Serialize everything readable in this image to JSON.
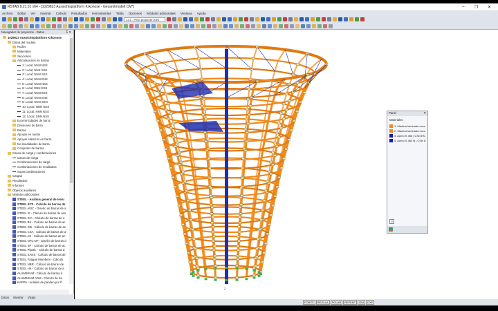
{
  "window": {
    "title": "RSTAB 8.21.01 x64 - [1029823 Aussichtsplattform Krkonose - Gesamtmodell CM*]",
    "minimize": "–",
    "maximize": "❐",
    "close": "✕"
  },
  "menu": [
    "Archivo",
    "Editar",
    "Ver",
    "Insertar",
    "Cálculo",
    "Resultados",
    "Herramientas",
    "Tabla",
    "Opciones",
    "Módulos adicionales",
    "Ventana",
    "Ayuda"
  ],
  "toolbar": {
    "load_case": "CC1 - Peso propio de la es"
  },
  "navigator": {
    "title": "Navegador de proyectos - Datos",
    "pin": "⊼ ✕",
    "items": [
      {
        "l": "1029823 Aussichtsplattform Krkonose",
        "d": 0,
        "t": "root"
      },
      {
        "l": "Datos del modelo",
        "d": 1,
        "t": "f"
      },
      {
        "l": "Nudos",
        "d": 2,
        "t": "f"
      },
      {
        "l": "Materiales",
        "d": 2,
        "t": "f"
      },
      {
        "l": "Secciones",
        "d": 2,
        "t": "f"
      },
      {
        "l": "Articulaciones en barras",
        "d": 2,
        "t": "f"
      },
      {
        "l": "1: Local; NNN NSS",
        "d": 3,
        "t": "h"
      },
      {
        "l": "2: Local; NNS SSS",
        "d": 3,
        "t": "h"
      },
      {
        "l": "3: Local; NNN SSS",
        "d": 3,
        "t": "h"
      },
      {
        "l": "4: Local; NNN ENS",
        "d": 3,
        "t": "h"
      },
      {
        "l": "5: Local; NNN NSS",
        "d": 3,
        "t": "h"
      },
      {
        "l": "6: Local; ENN ESS",
        "d": 3,
        "t": "h"
      },
      {
        "l": "7: Local; NNN ESS",
        "d": 3,
        "t": "h"
      },
      {
        "l": "8: Local; NNN ENE",
        "d": 3,
        "t": "h"
      },
      {
        "l": "9: Local; NNN SSN",
        "d": 3,
        "t": "h"
      },
      {
        "l": "10: Local; NNN NSS",
        "d": 3,
        "t": "h"
      },
      {
        "l": "11: Local; NNN NSS",
        "d": 3,
        "t": "h"
      },
      {
        "l": "12: Local; SNN NSS",
        "d": 3,
        "t": "h"
      },
      {
        "l": "Excentricidades de barra",
        "d": 2,
        "t": "f"
      },
      {
        "l": "Divisiones de barra",
        "d": 2,
        "t": "f"
      },
      {
        "l": "Barras",
        "d": 2,
        "t": "f"
      },
      {
        "l": "Apoyos en nudos",
        "d": 2,
        "t": "f"
      },
      {
        "l": "Apoyos elásticos en barra",
        "d": 2,
        "t": "f"
      },
      {
        "l": "No linealidades de barra",
        "d": 2,
        "t": "f"
      },
      {
        "l": "Conjuntos de barras",
        "d": 2,
        "t": "f"
      },
      {
        "l": "Casos de carga y combinaciones",
        "d": 1,
        "t": "f"
      },
      {
        "l": "Casos de carga",
        "d": 2,
        "t": "h"
      },
      {
        "l": "Combinaciones de carga",
        "d": 2,
        "t": "h"
      },
      {
        "l": "Combinaciones de resultados",
        "d": 2,
        "t": "h"
      },
      {
        "l": "Supercombinaciones",
        "d": 2,
        "t": "h"
      },
      {
        "l": "Cargas",
        "d": 1,
        "t": "f"
      },
      {
        "l": "Resultados",
        "d": 1,
        "t": "f"
      },
      {
        "l": "Informes",
        "d": 1,
        "t": "f"
      },
      {
        "l": "Objetos auxiliares",
        "d": 1,
        "t": "f"
      },
      {
        "l": "Módulos adicionales",
        "d": 1,
        "t": "f"
      },
      {
        "l": "STEEL - Análisis general de tensi",
        "d": 2,
        "t": "m",
        "b": 1
      },
      {
        "l": "STEEL EC3 - Cálculo de barras de",
        "d": 2,
        "t": "m",
        "b": 1
      },
      {
        "l": "STEEL AISC - Diseño de barras de a",
        "d": 2,
        "t": "m"
      },
      {
        "l": "STEEL IS - Cálculo de barras de acs",
        "d": 2,
        "t": "m"
      },
      {
        "l": "STEEL SIA - Cálculo de barras de a",
        "d": 2,
        "t": "m"
      },
      {
        "l": "STEEL BS - Cálculo de barras de ac",
        "d": 2,
        "t": "m"
      },
      {
        "l": "STEEL GB - Cálculo de barras de ac",
        "d": 2,
        "t": "m"
      },
      {
        "l": "STEEL CSA - Cálculo de barras de a",
        "d": 2,
        "t": "m"
      },
      {
        "l": "STEEL AS - Cálculo de barras de ac",
        "d": 2,
        "t": "m"
      },
      {
        "l": "STEEL NTC-DF - Diseño de barras d",
        "d": 2,
        "t": "m"
      },
      {
        "l": "STEEL SP - Cálculo de barras de ac",
        "d": 2,
        "t": "m"
      },
      {
        "l": "STEEL Plastic - Cálculo de barras d",
        "d": 2,
        "t": "m"
      },
      {
        "l": "STEEL SANS - Cálculo de barras de",
        "d": 2,
        "t": "m"
      },
      {
        "l": "STEEL Fatigue Members - Cálculo",
        "d": 2,
        "t": "m"
      },
      {
        "l": "STEEL NBR - Cálculo de barras de",
        "d": 2,
        "t": "m"
      },
      {
        "l": "STEEL HK - Cálculo de barras de a",
        "d": 2,
        "t": "m"
      },
      {
        "l": "ALUMINIUM - Cálculo de barras d",
        "d": 2,
        "t": "m"
      },
      {
        "l": "ALUMINIUM ADM - Cálculo de ba",
        "d": 2,
        "t": "m"
      },
      {
        "l": "KAPPA - Análisis de pandeo por fl",
        "d": 2,
        "t": "m"
      }
    ],
    "tabs": [
      "Datos",
      "Mostrar",
      "Vistas"
    ]
  },
  "panel": {
    "title": "Panel",
    "close": "✕",
    "section": "Materiales",
    "help": "?",
    "materials": [
      {
        "label": "1: Madera laminada enco",
        "color": "#f08a1c"
      },
      {
        "label": "2: Madera laminada enco",
        "color": "#f08a1c"
      },
      {
        "label": "3: Acero S 355 | CSN EN",
        "color": "#1a1aa0"
      },
      {
        "label": "4: Acero S 460 N | CSN E",
        "color": "#1a1ab0"
      }
    ]
  },
  "view": {
    "axis_label": "Z"
  },
  "status": [
    "FORZC",
    "REJILLA",
    "POLAR",
    "REFENT",
    "GUI",
    "DXF"
  ],
  "colors": {
    "timber": "#f08a1c",
    "steel": "#1f2fb0",
    "support": "#3cb44b"
  }
}
